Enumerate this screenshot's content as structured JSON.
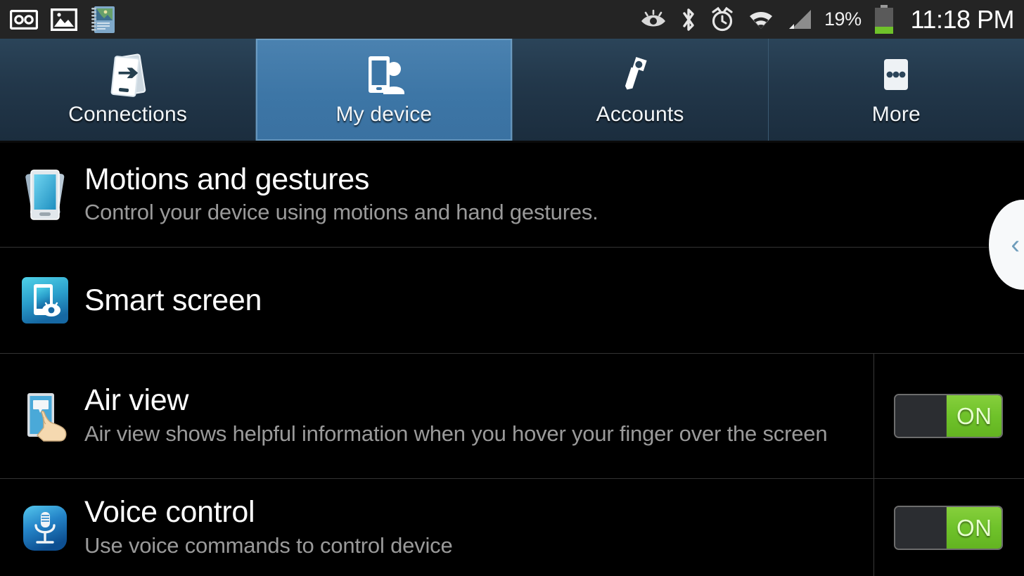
{
  "statusbar": {
    "left_icons": [
      {
        "name": "voicemail-icon"
      },
      {
        "name": "image-icon"
      },
      {
        "name": "notebook-icon"
      }
    ],
    "right_icons": [
      {
        "name": "smart-stay-eye-icon"
      },
      {
        "name": "bluetooth-icon"
      },
      {
        "name": "alarm-icon"
      },
      {
        "name": "wifi-icon"
      },
      {
        "name": "cell-signal-icon"
      }
    ],
    "battery_percent": "19%",
    "battery_icon": "battery-icon",
    "clock": "11:18 PM"
  },
  "tabs": [
    {
      "label": "Connections",
      "icon": "connections-icon",
      "active": false
    },
    {
      "label": "My device",
      "icon": "my-device-icon",
      "active": true
    },
    {
      "label": "Accounts",
      "icon": "accounts-key-icon",
      "active": false
    },
    {
      "label": "More",
      "icon": "more-dots-icon",
      "active": false
    }
  ],
  "settings": [
    {
      "id": "motions",
      "title": "Motions and gestures",
      "subtitle": "Control your device using motions and hand gestures.",
      "icon": "motions-gestures-icon",
      "has_toggle": false
    },
    {
      "id": "smart-screen",
      "title": "Smart screen",
      "subtitle": "",
      "icon": "smart-screen-icon",
      "has_toggle": false
    },
    {
      "id": "air-view",
      "title": "Air view",
      "subtitle": "Air view shows helpful information when you hover your finger over the screen",
      "icon": "air-view-icon",
      "has_toggle": true,
      "toggle_label": "ON",
      "toggle_state": "on"
    },
    {
      "id": "voice-control",
      "title": "Voice control",
      "subtitle": "Use voice commands to control device",
      "icon": "voice-control-icon",
      "has_toggle": true,
      "toggle_label": "ON",
      "toggle_state": "on"
    }
  ],
  "edge_handle": {
    "name": "edge-panel-handle",
    "chevron": "‹"
  },
  "colors": {
    "tab_active": "#3d76a6",
    "tab_inactive": "#22374a",
    "toggle_on": "#6fc22a",
    "background": "#000000",
    "title_text": "#ffffff",
    "subtitle_text": "#9a9a9a",
    "status_bar": "#242424"
  }
}
